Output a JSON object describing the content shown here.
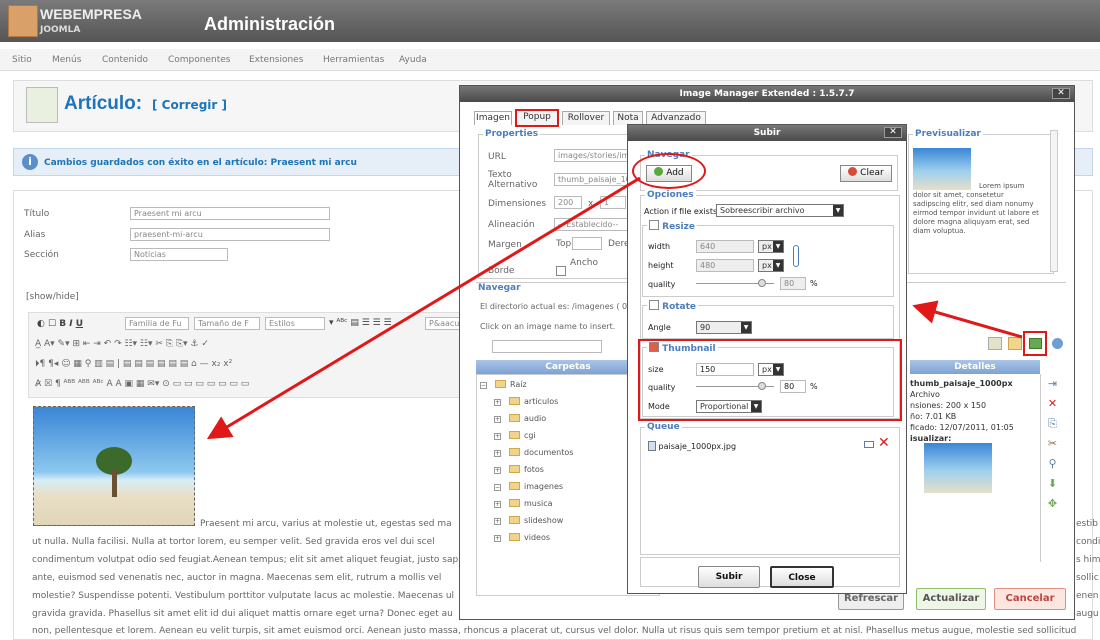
{
  "header": {
    "brand": "WEBEMPRESA",
    "brand_sub": "JOOMLA",
    "title": "Administración"
  },
  "menu": [
    "Sitio",
    "Menús",
    "Contenido",
    "Componentes",
    "Extensiones",
    "Herramientas",
    "Ayuda"
  ],
  "page": {
    "title": "Artículo:",
    "title_sub": "[ Corregir ]"
  },
  "message": "Cambios guardados con éxito en el artículo: Praesent mi arcu",
  "form": {
    "titulo_label": "Título",
    "titulo_value": "Praesent mi arcu",
    "alias_label": "Alias",
    "alias_value": "praesent-mi-arcu",
    "seccion_label": "Sección",
    "seccion_value": "Noticias",
    "showhide": "[show/hide]"
  },
  "editor": {
    "font_family": "Familia de Fu",
    "font_size": "Tamaño de F",
    "styles": "Estilos",
    "paragraph": "P&aacu",
    "lines": [
      "Praesent mi arcu, varius at molestie ut, egestas sed ma",
      "ut nulla. Nulla facilisi. Nulla at tortor lorem, eu semper velit. Sed gravida eros vel dui scel",
      "condimentum volutpat odio sed feugiat.Aenean tempus; elit sit amet aliquet feugiat, justo sap",
      "ante, euismod sed venenatis nec, auctor in magna. Maecenas sem elit, rutrum a mollis vel",
      "molestie? Suspendisse potenti. Vestibulum porttitor vulputate lacus ac molestie. Maecenas ul",
      "gravida gravida. Phasellus sit amet elit id dui aliquet mattis ornare eget urna? Donec eget au",
      "non, pellentesque et lorem. Aenean eu velit turpis, sit amet euismod orci. Aenean justo massa, rhoncus a placerat ut, cursus vel dolor. Nulla ut risus quis sem tempor pretium et at nisl. Phasellus metus augue, molestie sed sollicitud"
    ],
    "right_frag": [
      "estib",
      "condi",
      "s him",
      "sollic",
      "enen",
      "augu"
    ]
  },
  "ime": {
    "title": "Image Manager Extended : 1.5.7.7",
    "tabs": [
      "Imagen",
      "Popup",
      "Rollover",
      "Nota",
      "Advanzado"
    ],
    "properties_legend": "Properties",
    "url_label": "URL",
    "url_value": "images/stories/im",
    "alt_label": "Texto Alternativo",
    "alt_value": "thumb_paisaje_10",
    "dim_label": "Dimensiones",
    "dim_w": "200",
    "dim_sep": "x",
    "dim_h": "1",
    "align_label": "Alineación",
    "align_value": "-- Establecido--",
    "margin_label": "Margen",
    "margin_top": "Top",
    "margin_right": "Dere",
    "border_label": "Borde",
    "border_width": "Ancho",
    "preview_legend": "Previsualizar",
    "preview_text": "Lorem ipsum dolor sit amet, consetetur sadipscing elitr, sed diam nonumy eirmod tempor invidunt ut labore et dolore magna aliquyam erat, sed diam voluptua.",
    "nav_legend": "Navegar",
    "current_dir": "El directorio actual es: /imagenes ( 0",
    "click_hint": "Click on an image name to insert.",
    "folders_head": "Carpetas",
    "details_head": "Detalles",
    "root": "Raíz",
    "folders": [
      "articulos",
      "audio",
      "cgi",
      "documentos",
      "fotos",
      "imagenes",
      "musica",
      "slideshow",
      "videos"
    ],
    "details": [
      "thumb_paisaje_1000px",
      "Archivo",
      "nsiones: 200 x 150",
      "ño: 7.01 KB",
      "ficado: 12/07/2011, 01:05",
      "isualizar:"
    ],
    "btn_refresh": "Refrescar",
    "btn_update": "Actualizar",
    "btn_cancel": "Cancelar"
  },
  "upload": {
    "title": "Subir",
    "nav_legend": "Navegar",
    "add": "Add",
    "clear": "Clear",
    "options_legend": "Opciones",
    "action_label": "Action if file exists:",
    "action_value": "Sobreescribir archivo",
    "resize_legend": "Resize",
    "width_label": "width",
    "width_value": "640",
    "width_unit": "px",
    "height_label": "height",
    "height_value": "480",
    "height_unit": "px",
    "quality_label": "quality",
    "quality_value": "80",
    "pct": "%",
    "rotate_legend": "Rotate",
    "angle_label": "Angle",
    "angle_value": "90",
    "thumb_legend": "Thumbnail",
    "size_label": "size",
    "size_value": "150",
    "size_unit": "px",
    "tq_label": "quality",
    "tq_value": "80",
    "mode_label": "Mode",
    "mode_value": "Proportional",
    "queue_legend": "Queue",
    "queue_file": "paisaje_1000px.jpg",
    "btn_upload": "Subir",
    "btn_close": "Close"
  },
  "colors": {
    "accent_red": "#e01818",
    "brand_blue": "#1c75b8"
  }
}
